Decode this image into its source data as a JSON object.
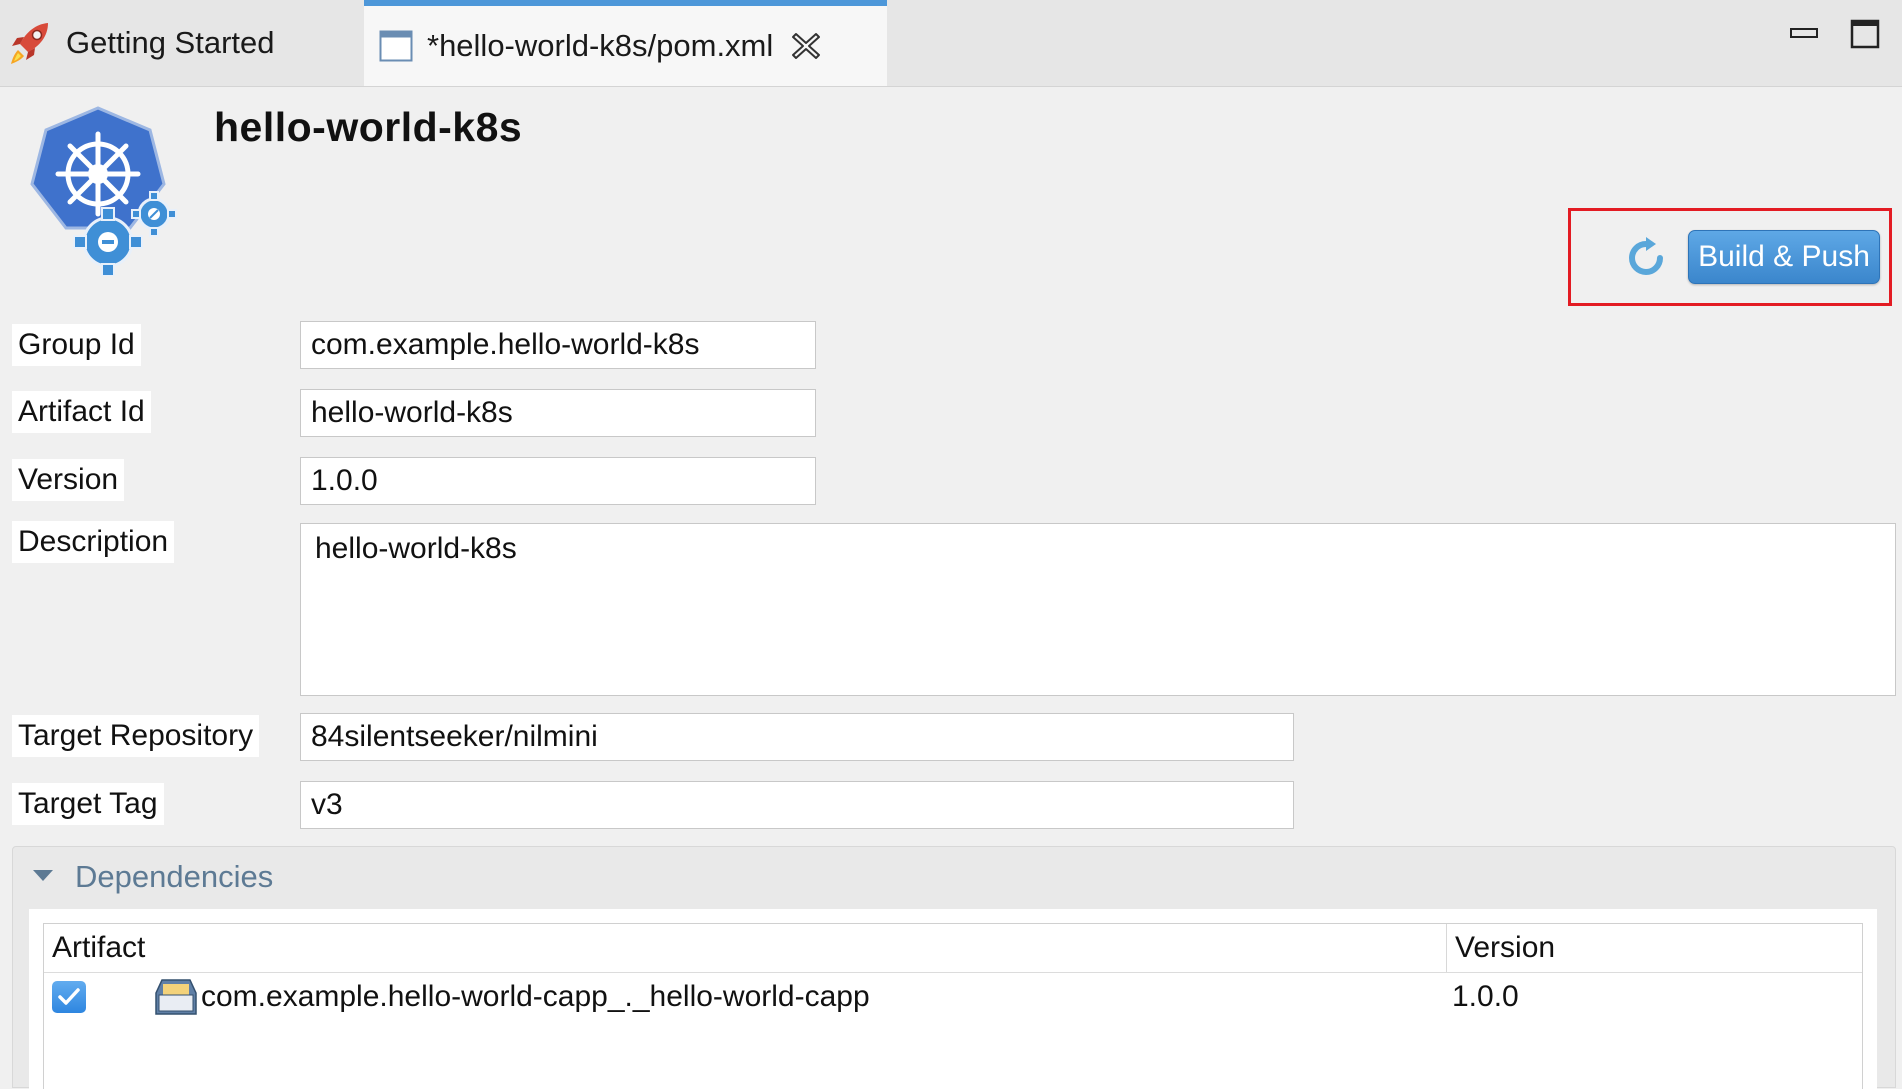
{
  "tabs": [
    {
      "label": "Getting Started",
      "icon": "rocket-icon",
      "active": false
    },
    {
      "label": "*hello-world-k8s/pom.xml",
      "icon": "editor-file-icon",
      "active": true
    }
  ],
  "header": {
    "project_title": "hello-world-k8s",
    "logo_icon": "kubernetes-gears-icon"
  },
  "toolbar": {
    "build_push_label": "Build & Push",
    "refresh_icon": "refresh-icon",
    "highlight_color": "#e31b23",
    "button_color": "#4a97db"
  },
  "form": {
    "group_id": {
      "label": "Group Id",
      "value": "com.example.hello-world-k8s"
    },
    "artifact_id": {
      "label": "Artifact Id",
      "value": "hello-world-k8s"
    },
    "version": {
      "label": "Version",
      "value": "1.0.0"
    },
    "description": {
      "label": "Description",
      "value": "hello-world-k8s"
    },
    "target_repository": {
      "label": "Target Repository",
      "value": "84silentseeker/nilmini"
    },
    "target_tag": {
      "label": "Target Tag",
      "value": "v3"
    }
  },
  "dependencies": {
    "title": "Dependencies",
    "columns": [
      "Artifact",
      "Version"
    ],
    "rows": [
      {
        "checked": true,
        "artifact": "com.example.hello-world-capp_._hello-world-capp",
        "version": "1.0.0"
      }
    ]
  }
}
